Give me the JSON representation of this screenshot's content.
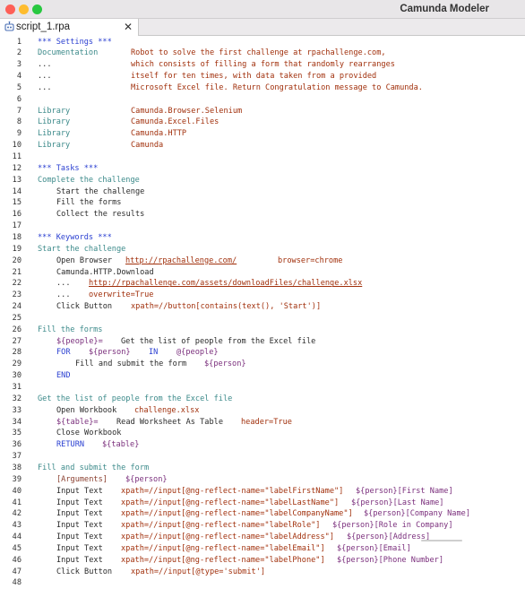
{
  "window": {
    "title": "Camunda Modeler"
  },
  "traffic_lights": {
    "close": "#fe5f57",
    "minimize": "#febc2e",
    "zoom": "#28c840"
  },
  "tab": {
    "label": "script_1.rpa",
    "close_glyph": "✕",
    "icon": "robot-icon"
  },
  "lines": [
    {
      "n": "1",
      "parts": [
        {
          "t": "*** Settings ***",
          "c": "section"
        }
      ]
    },
    {
      "n": "2",
      "parts": [
        {
          "t": "Documentation",
          "c": "teal"
        },
        {
          "t": "Robot to solve the first challenge at rpachallenge.com,",
          "c": "red",
          "col": 146
        }
      ]
    },
    {
      "n": "3",
      "parts": [
        {
          "t": "...",
          "c": "plain"
        },
        {
          "t": "which consists of filling a form that randomly rearranges",
          "c": "red",
          "col": 146
        }
      ]
    },
    {
      "n": "4",
      "parts": [
        {
          "t": "...",
          "c": "plain"
        },
        {
          "t": "itself for ten times, with data taken from a provided",
          "c": "red",
          "col": 146
        }
      ]
    },
    {
      "n": "5",
      "parts": [
        {
          "t": "...",
          "c": "plain"
        },
        {
          "t": "Microsoft Excel file. Return Congratulation message to Camunda.",
          "c": "red",
          "col": 146
        }
      ]
    },
    {
      "n": "6",
      "parts": []
    },
    {
      "n": "7",
      "parts": [
        {
          "t": "Library",
          "c": "teal"
        },
        {
          "t": "Camunda.Browser.Selenium",
          "c": "red",
          "col": 146
        }
      ]
    },
    {
      "n": "8",
      "parts": [
        {
          "t": "Library",
          "c": "teal"
        },
        {
          "t": "Camunda.Excel.Files",
          "c": "red",
          "col": 146
        }
      ]
    },
    {
      "n": "9",
      "parts": [
        {
          "t": "Library",
          "c": "teal"
        },
        {
          "t": "Camunda.HTTP",
          "c": "red",
          "col": 146
        }
      ]
    },
    {
      "n": "10",
      "parts": [
        {
          "t": "Library",
          "c": "teal"
        },
        {
          "t": "Camunda",
          "c": "red",
          "col": 146
        }
      ]
    },
    {
      "n": "11",
      "parts": []
    },
    {
      "n": "12",
      "parts": [
        {
          "t": "*** Tasks ***",
          "c": "section"
        }
      ]
    },
    {
      "n": "13",
      "parts": [
        {
          "t": "Complete the challenge",
          "c": "teal"
        }
      ]
    },
    {
      "n": "14",
      "parts": [
        {
          "t": "Start the challenge",
          "c": "plain",
          "col": 63
        }
      ]
    },
    {
      "n": "15",
      "parts": [
        {
          "t": "Fill the forms",
          "c": "plain",
          "col": 63
        }
      ]
    },
    {
      "n": "16",
      "parts": [
        {
          "t": "Collect the results",
          "c": "plain",
          "col": 63
        }
      ]
    },
    {
      "n": "17",
      "parts": []
    },
    {
      "n": "18",
      "parts": [
        {
          "t": "*** Keywords ***",
          "c": "section"
        }
      ]
    },
    {
      "n": "19",
      "parts": [
        {
          "t": "Start the challenge",
          "c": "teal"
        }
      ]
    },
    {
      "n": "20",
      "parts": [
        {
          "t": "Open Browser",
          "c": "plain",
          "col": 63
        },
        {
          "t": "http://rpachallenge.com/",
          "c": "link",
          "col": 140
        },
        {
          "t": "browser=chrome",
          "c": "red",
          "col": 310
        }
      ]
    },
    {
      "n": "21",
      "parts": [
        {
          "t": "Camunda.HTTP.Download",
          "c": "plain",
          "col": 63
        }
      ]
    },
    {
      "n": "22",
      "parts": [
        {
          "t": "...",
          "c": "plain",
          "col": 63
        },
        {
          "t": "http://rpachallenge.com/assets/downloadFiles/challenge.xlsx",
          "c": "link",
          "col": 99
        }
      ]
    },
    {
      "n": "23",
      "parts": [
        {
          "t": "...",
          "c": "plain",
          "col": 63
        },
        {
          "t": "overwrite=True",
          "c": "red",
          "col": 99
        }
      ]
    },
    {
      "n": "24",
      "parts": [
        {
          "t": "Click Button",
          "c": "plain",
          "col": 63
        },
        {
          "t": "xpath=//button[contains(text(), 'Start')]",
          "c": "red",
          "col": 146
        }
      ]
    },
    {
      "n": "25",
      "parts": []
    },
    {
      "n": "26",
      "parts": [
        {
          "t": "Fill the forms",
          "c": "teal"
        }
      ]
    },
    {
      "n": "27",
      "parts": [
        {
          "t": "${people}=",
          "c": "var",
          "col": 63
        },
        {
          "t": "Get the list of people from the Excel file",
          "c": "plain",
          "col": 135
        }
      ]
    },
    {
      "n": "28",
      "parts": [
        {
          "t": "FOR",
          "c": "blue",
          "col": 63
        },
        {
          "t": "${person}",
          "c": "var",
          "col": 99
        },
        {
          "t": "IN",
          "c": "blue",
          "col": 166
        },
        {
          "t": "@{people}",
          "c": "var",
          "col": 197
        }
      ]
    },
    {
      "n": "29",
      "parts": [
        {
          "t": "Fill and submit the form",
          "c": "plain",
          "col": 84
        },
        {
          "t": "${person}",
          "c": "var",
          "col": 228
        }
      ]
    },
    {
      "n": "30",
      "parts": [
        {
          "t": "END",
          "c": "blue",
          "col": 63
        }
      ]
    },
    {
      "n": "31",
      "parts": []
    },
    {
      "n": "32",
      "parts": [
        {
          "t": "Get the list of people from the Excel file",
          "c": "teal"
        }
      ]
    },
    {
      "n": "33",
      "parts": [
        {
          "t": "Open Workbook",
          "c": "plain",
          "col": 63
        },
        {
          "t": "challenge.xlsx",
          "c": "red",
          "col": 150
        }
      ]
    },
    {
      "n": "34",
      "parts": [
        {
          "t": "${table}=",
          "c": "var",
          "col": 63
        },
        {
          "t": "Read Worksheet As Table",
          "c": "plain",
          "col": 130
        },
        {
          "t": "header=True",
          "c": "red",
          "col": 269
        }
      ]
    },
    {
      "n": "35",
      "parts": [
        {
          "t": "Close Workbook",
          "c": "plain",
          "col": 63
        }
      ]
    },
    {
      "n": "36",
      "parts": [
        {
          "t": "RETURN",
          "c": "blue",
          "col": 63
        },
        {
          "t": "${table}",
          "c": "var",
          "col": 114
        }
      ]
    },
    {
      "n": "37",
      "parts": []
    },
    {
      "n": "38",
      "parts": [
        {
          "t": "Fill and submit the form",
          "c": "teal"
        }
      ]
    },
    {
      "n": "39",
      "parts": [
        {
          "t": "[Arguments]",
          "c": "brown",
          "col": 63
        },
        {
          "t": "${person}",
          "c": "var",
          "col": 140
        }
      ]
    },
    {
      "n": "40",
      "parts": [
        {
          "t": "Input Text",
          "c": "plain",
          "col": 63
        },
        {
          "t": "xpath=//input[@ng-reflect-name=\"labelFirstName\"]",
          "c": "red",
          "col": 135
        },
        {
          "t": "${person}[First Name]",
          "c": "var",
          "col": 397
        }
      ]
    },
    {
      "n": "41",
      "parts": [
        {
          "t": "Input Text",
          "c": "plain",
          "col": 63
        },
        {
          "t": "xpath=//input[@ng-reflect-name=\"labelLastName\"]",
          "c": "red",
          "col": 135
        },
        {
          "t": "${person}[Last Name]",
          "c": "var",
          "col": 392
        }
      ]
    },
    {
      "n": "42",
      "parts": [
        {
          "t": "Input Text",
          "c": "plain",
          "col": 63
        },
        {
          "t": "xpath=//input[@ng-reflect-name=\"labelCompanyName\"]",
          "c": "red",
          "col": 135
        },
        {
          "t": "${person}[Company Name]",
          "c": "var",
          "col": 406
        }
      ]
    },
    {
      "n": "43",
      "parts": [
        {
          "t": "Input Text",
          "c": "plain",
          "col": 63
        },
        {
          "t": "xpath=//input[@ng-reflect-name=\"labelRole\"]",
          "c": "red",
          "col": 135
        },
        {
          "t": "${person}[Role in Company]",
          "c": "var",
          "col": 371
        }
      ]
    },
    {
      "n": "44",
      "parts": [
        {
          "t": "Input Text",
          "c": "plain",
          "col": 63
        },
        {
          "t": "xpath=//input[@ng-reflect-name=\"labelAddress\"]",
          "c": "red",
          "col": 135
        },
        {
          "t": "${person}[Address]",
          "c": "var",
          "col": 387
        }
      ]
    },
    {
      "n": "45",
      "parts": [
        {
          "t": "Input Text",
          "c": "plain",
          "col": 63
        },
        {
          "t": "xpath=//input[@ng-reflect-name=\"labelEmail\"]",
          "c": "red",
          "col": 135
        },
        {
          "t": "${person}[Email]",
          "c": "var",
          "col": 376
        }
      ]
    },
    {
      "n": "46",
      "parts": [
        {
          "t": "Input Text",
          "c": "plain",
          "col": 63
        },
        {
          "t": "xpath=//input[@ng-reflect-name=\"labelPhone\"]",
          "c": "red",
          "col": 135
        },
        {
          "t": "${person}[Phone Number]",
          "c": "var",
          "col": 376
        }
      ]
    },
    {
      "n": "47",
      "parts": [
        {
          "t": "Click Button",
          "c": "plain",
          "col": 63
        },
        {
          "t": "xpath=//input[@type='submit']",
          "c": "red",
          "col": 146
        }
      ]
    },
    {
      "n": "48",
      "parts": []
    }
  ]
}
